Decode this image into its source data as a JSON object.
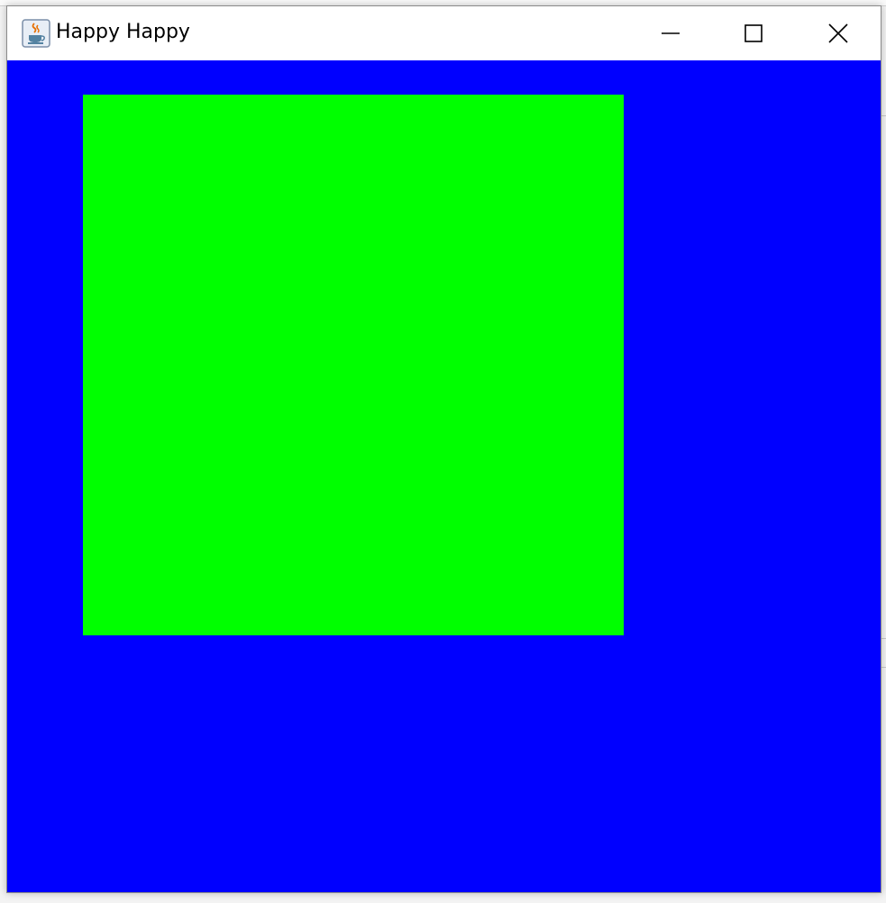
{
  "window": {
    "title": "Happy Happy",
    "icon": "java-cup-icon",
    "controls": [
      "minimize-icon",
      "maximize-icon",
      "close-icon"
    ]
  },
  "canvas": {
    "background_color": "#0000ff",
    "shape": {
      "type": "filled-rectangle",
      "color": "#00ff00"
    }
  }
}
